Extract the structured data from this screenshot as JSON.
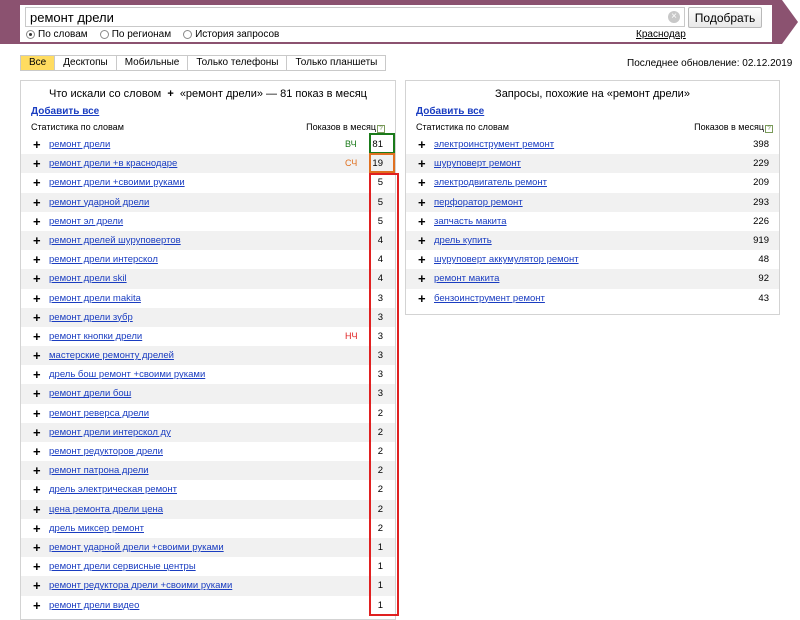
{
  "search": {
    "query": "ремонт дрели",
    "submit_label": "Подобрать",
    "clear_icon": "×"
  },
  "modes": [
    {
      "label": "По словам",
      "selected": true
    },
    {
      "label": "По регионам",
      "selected": false
    },
    {
      "label": "История запросов",
      "selected": false
    }
  ],
  "region": "Краснодар",
  "tabs": [
    "Все",
    "Десктопы",
    "Мобильные",
    "Только телефоны",
    "Только планшеты"
  ],
  "updated": "Последнее обновление: 02.12.2019",
  "colors": {
    "header": "#8b5270",
    "link": "#1a3dc1",
    "active_tab": "#ffdc60",
    "hf": "#1a7a1a",
    "mf": "#e07020",
    "lf": "#e02020"
  },
  "left": {
    "title_before": "Что искали со словом",
    "title_plus": "+",
    "title_after": "«ремонт дрели» — 81 показ в месяц",
    "add_all": "Добавить все",
    "col_phrase": "Статистика по словам",
    "col_count": "Показов в месяц",
    "rows": [
      {
        "phrase": "ремонт дрели",
        "tag": "ВЧ",
        "count": "81"
      },
      {
        "phrase": "ремонт дрели +в краснодаре",
        "tag": "СЧ",
        "count": "19"
      },
      {
        "phrase": "ремонт дрели +своими руками",
        "tag": "",
        "count": "5"
      },
      {
        "phrase": "ремонт ударной дрели",
        "tag": "",
        "count": "5"
      },
      {
        "phrase": "ремонт эл дрели",
        "tag": "",
        "count": "5"
      },
      {
        "phrase": "ремонт дрелей шуруповертов",
        "tag": "",
        "count": "4"
      },
      {
        "phrase": "ремонт дрели интерскол",
        "tag": "",
        "count": "4"
      },
      {
        "phrase": "ремонт дрели skil",
        "tag": "",
        "count": "4"
      },
      {
        "phrase": "ремонт дрели makita",
        "tag": "",
        "count": "3"
      },
      {
        "phrase": "ремонт дрели зубр",
        "tag": "",
        "count": "3"
      },
      {
        "phrase": "ремонт кнопки дрели",
        "tag": "НЧ",
        "count": "3"
      },
      {
        "phrase": "мастерские ремонту дрелей",
        "tag": "",
        "count": "3"
      },
      {
        "phrase": "дрель бош ремонт +своими руками",
        "tag": "",
        "count": "3"
      },
      {
        "phrase": "ремонт дрели бош",
        "tag": "",
        "count": "3"
      },
      {
        "phrase": "ремонт реверса дрели",
        "tag": "",
        "count": "2"
      },
      {
        "phrase": "ремонт дрели интерскол ду",
        "tag": "",
        "count": "2"
      },
      {
        "phrase": "ремонт редукторов дрели",
        "tag": "",
        "count": "2"
      },
      {
        "phrase": "ремонт патрона дрели",
        "tag": "",
        "count": "2"
      },
      {
        "phrase": "дрель электрическая ремонт",
        "tag": "",
        "count": "2"
      },
      {
        "phrase": "цена ремонта дрели цена",
        "tag": "",
        "count": "2"
      },
      {
        "phrase": "дрель миксер ремонт",
        "tag": "",
        "count": "2"
      },
      {
        "phrase": "ремонт ударной дрели +своими руками",
        "tag": "",
        "count": "1"
      },
      {
        "phrase": "ремонт дрели сервисные центры",
        "tag": "",
        "count": "1"
      },
      {
        "phrase": "ремонт редуктора дрели +своими руками",
        "tag": "",
        "count": "1"
      },
      {
        "phrase": "ремонт дрели видео",
        "tag": "",
        "count": "1"
      }
    ]
  },
  "right": {
    "title": "Запросы, похожие на «ремонт дрели»",
    "add_all": "Добавить все",
    "col_phrase": "Статистика по словам",
    "col_count": "Показов в месяц",
    "rows": [
      {
        "phrase": "электроинструмент ремонт",
        "count": "398"
      },
      {
        "phrase": "шуруповерт ремонт",
        "count": "229"
      },
      {
        "phrase": "электродвигатель ремонт",
        "count": "209"
      },
      {
        "phrase": "перфоратор ремонт",
        "count": "293"
      },
      {
        "phrase": "запчасть макита",
        "count": "226"
      },
      {
        "phrase": "дрель купить",
        "count": "919"
      },
      {
        "phrase": "шуруповерт аккумулятор ремонт",
        "count": "48"
      },
      {
        "phrase": "ремонт макита",
        "count": "92"
      },
      {
        "phrase": "бензоинструмент ремонт",
        "count": "43"
      }
    ]
  }
}
